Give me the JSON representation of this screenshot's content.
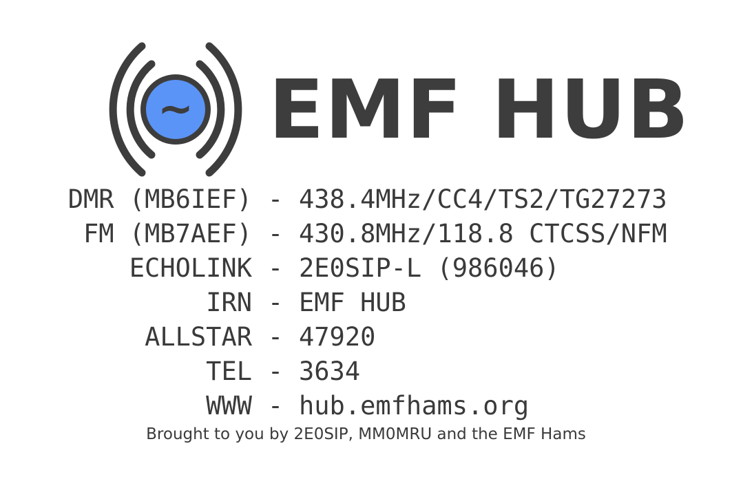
{
  "brand": {
    "title": "EMF HUB",
    "logo_icon": "radio-broadcast-icon",
    "logo_glyph": "~",
    "colors": {
      "dark": "#3d3d3d",
      "accent": "#5b94f7"
    }
  },
  "entries": [
    {
      "label": "DMR (MB6IEF)",
      "separator": "-",
      "value": "438.4MHz/CC4/TS2/TG27273"
    },
    {
      "label": "FM (MB7AEF)",
      "separator": "-",
      "value": "430.8MHz/118.8 CTCSS/NFM"
    },
    {
      "label": "ECHOLINK",
      "separator": "-",
      "value": "2E0SIP-L (986046)"
    },
    {
      "label": "IRN",
      "separator": "-",
      "value": "EMF HUB"
    },
    {
      "label": "ALLSTAR",
      "separator": "-",
      "value": "47920"
    },
    {
      "label": "TEL",
      "separator": "-",
      "value": "3634"
    },
    {
      "label": "WWW",
      "separator": "-",
      "value": "hub.emfhams.org"
    }
  ],
  "footer": {
    "credit": "Brought to you by 2E0SIP, MM0MRU and the EMF Hams"
  }
}
